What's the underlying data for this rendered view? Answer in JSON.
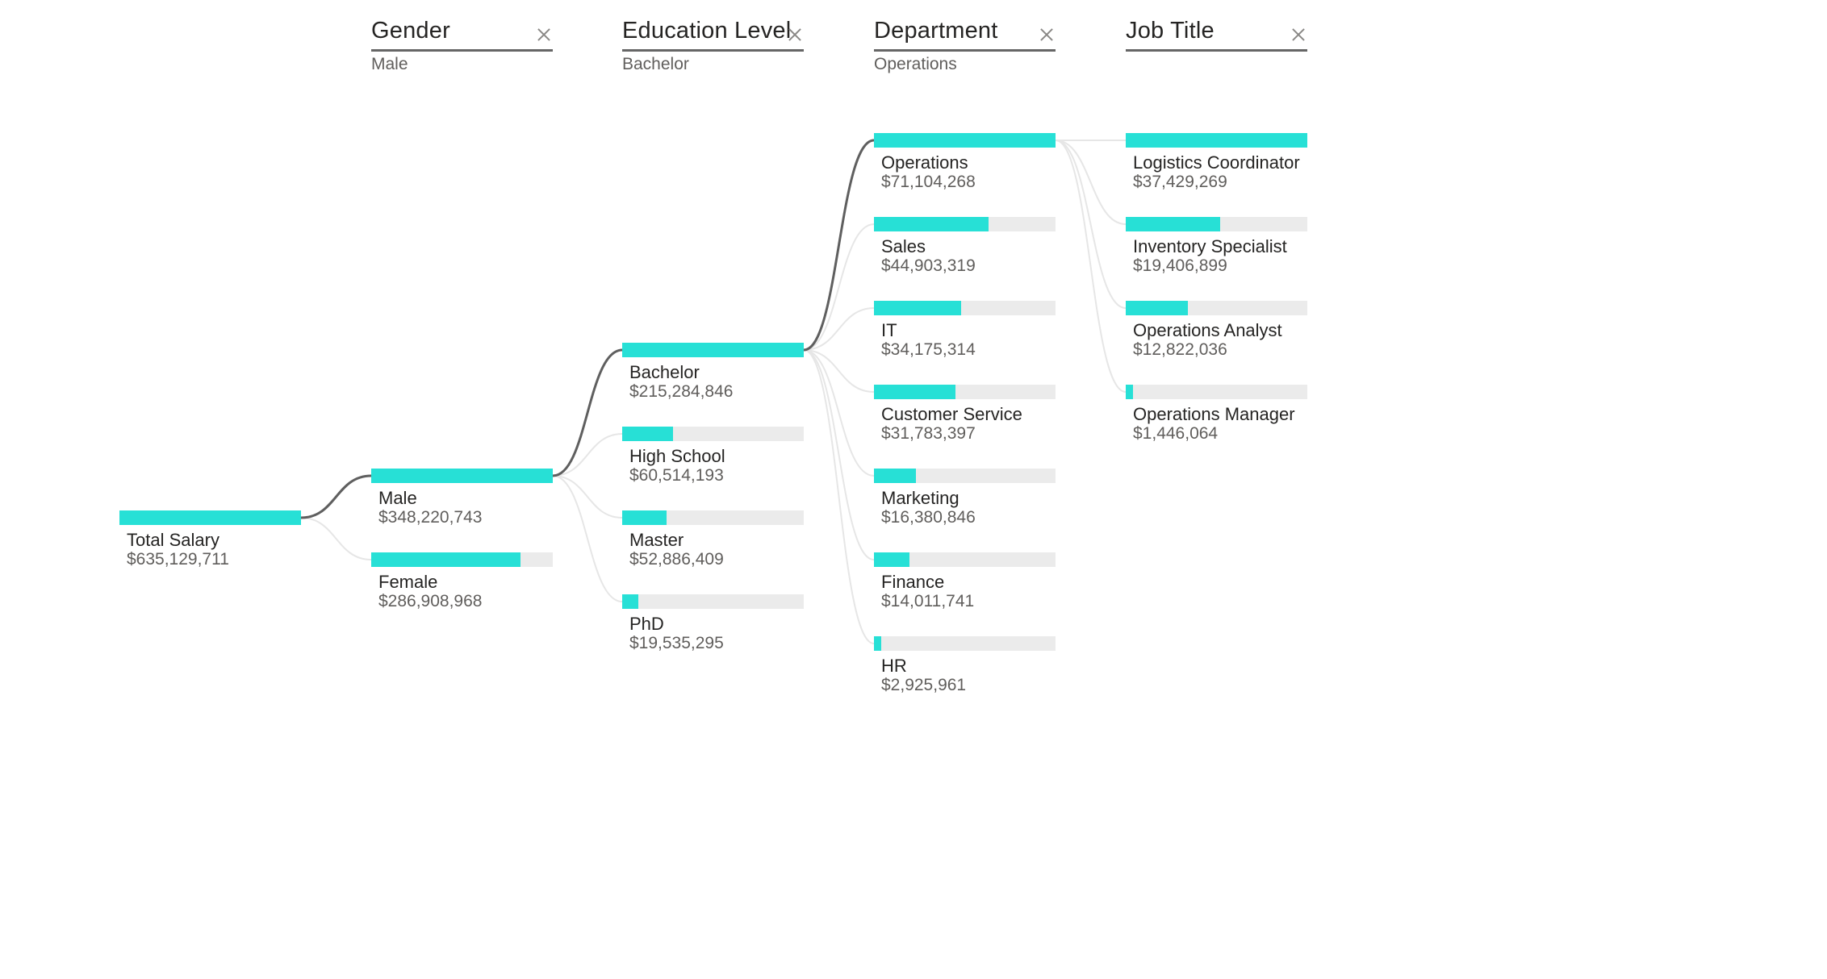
{
  "chart_data": {
    "type": "decomposition-tree",
    "colors": {
      "bar": "#27e0d6",
      "track": "#ebebeb",
      "active_path": "#5f5f5f",
      "inactive_path": "#e6e6e6"
    },
    "root": {
      "label": "Total Salary",
      "value_text": "$635,129,711",
      "value": 635129711
    },
    "levels": [
      {
        "title": "Gender",
        "selected": "Male",
        "nodes": [
          {
            "label": "Male",
            "value_text": "$348,220,743",
            "value": 348220743
          },
          {
            "label": "Female",
            "value_text": "$286,908,968",
            "value": 286908968
          }
        ]
      },
      {
        "title": "Education Level",
        "selected": "Bachelor",
        "nodes": [
          {
            "label": "Bachelor",
            "value_text": "$215,284,846",
            "value": 215284846
          },
          {
            "label": "High School",
            "value_text": "$60,514,193",
            "value": 60514193
          },
          {
            "label": "Master",
            "value_text": "$52,886,409",
            "value": 52886409
          },
          {
            "label": "PhD",
            "value_text": "$19,535,295",
            "value": 19535295
          }
        ]
      },
      {
        "title": "Department",
        "selected": "Operations",
        "nodes": [
          {
            "label": "Operations",
            "value_text": "$71,104,268",
            "value": 71104268
          },
          {
            "label": "Sales",
            "value_text": "$44,903,319",
            "value": 44903319
          },
          {
            "label": "IT",
            "value_text": "$34,175,314",
            "value": 34175314
          },
          {
            "label": "Customer Service",
            "value_text": "$31,783,397",
            "value": 31783397
          },
          {
            "label": "Marketing",
            "value_text": "$16,380,846",
            "value": 16380846
          },
          {
            "label": "Finance",
            "value_text": "$14,011,741",
            "value": 14011741
          },
          {
            "label": "HR",
            "value_text": "$2,925,961",
            "value": 2925961
          }
        ]
      },
      {
        "title": "Job Title",
        "selected": "",
        "nodes": [
          {
            "label": "Logistics Coordinator",
            "value_text": "$37,429,269",
            "value": 37429269
          },
          {
            "label": "Inventory Specialist",
            "value_text": "$19,406,899",
            "value": 19406899
          },
          {
            "label": "Operations Analyst",
            "value_text": "$12,822,036",
            "value": 12822036
          },
          {
            "label": "Operations Manager",
            "value_text": "$1,446,064",
            "value": 1446064
          }
        ]
      }
    ]
  }
}
